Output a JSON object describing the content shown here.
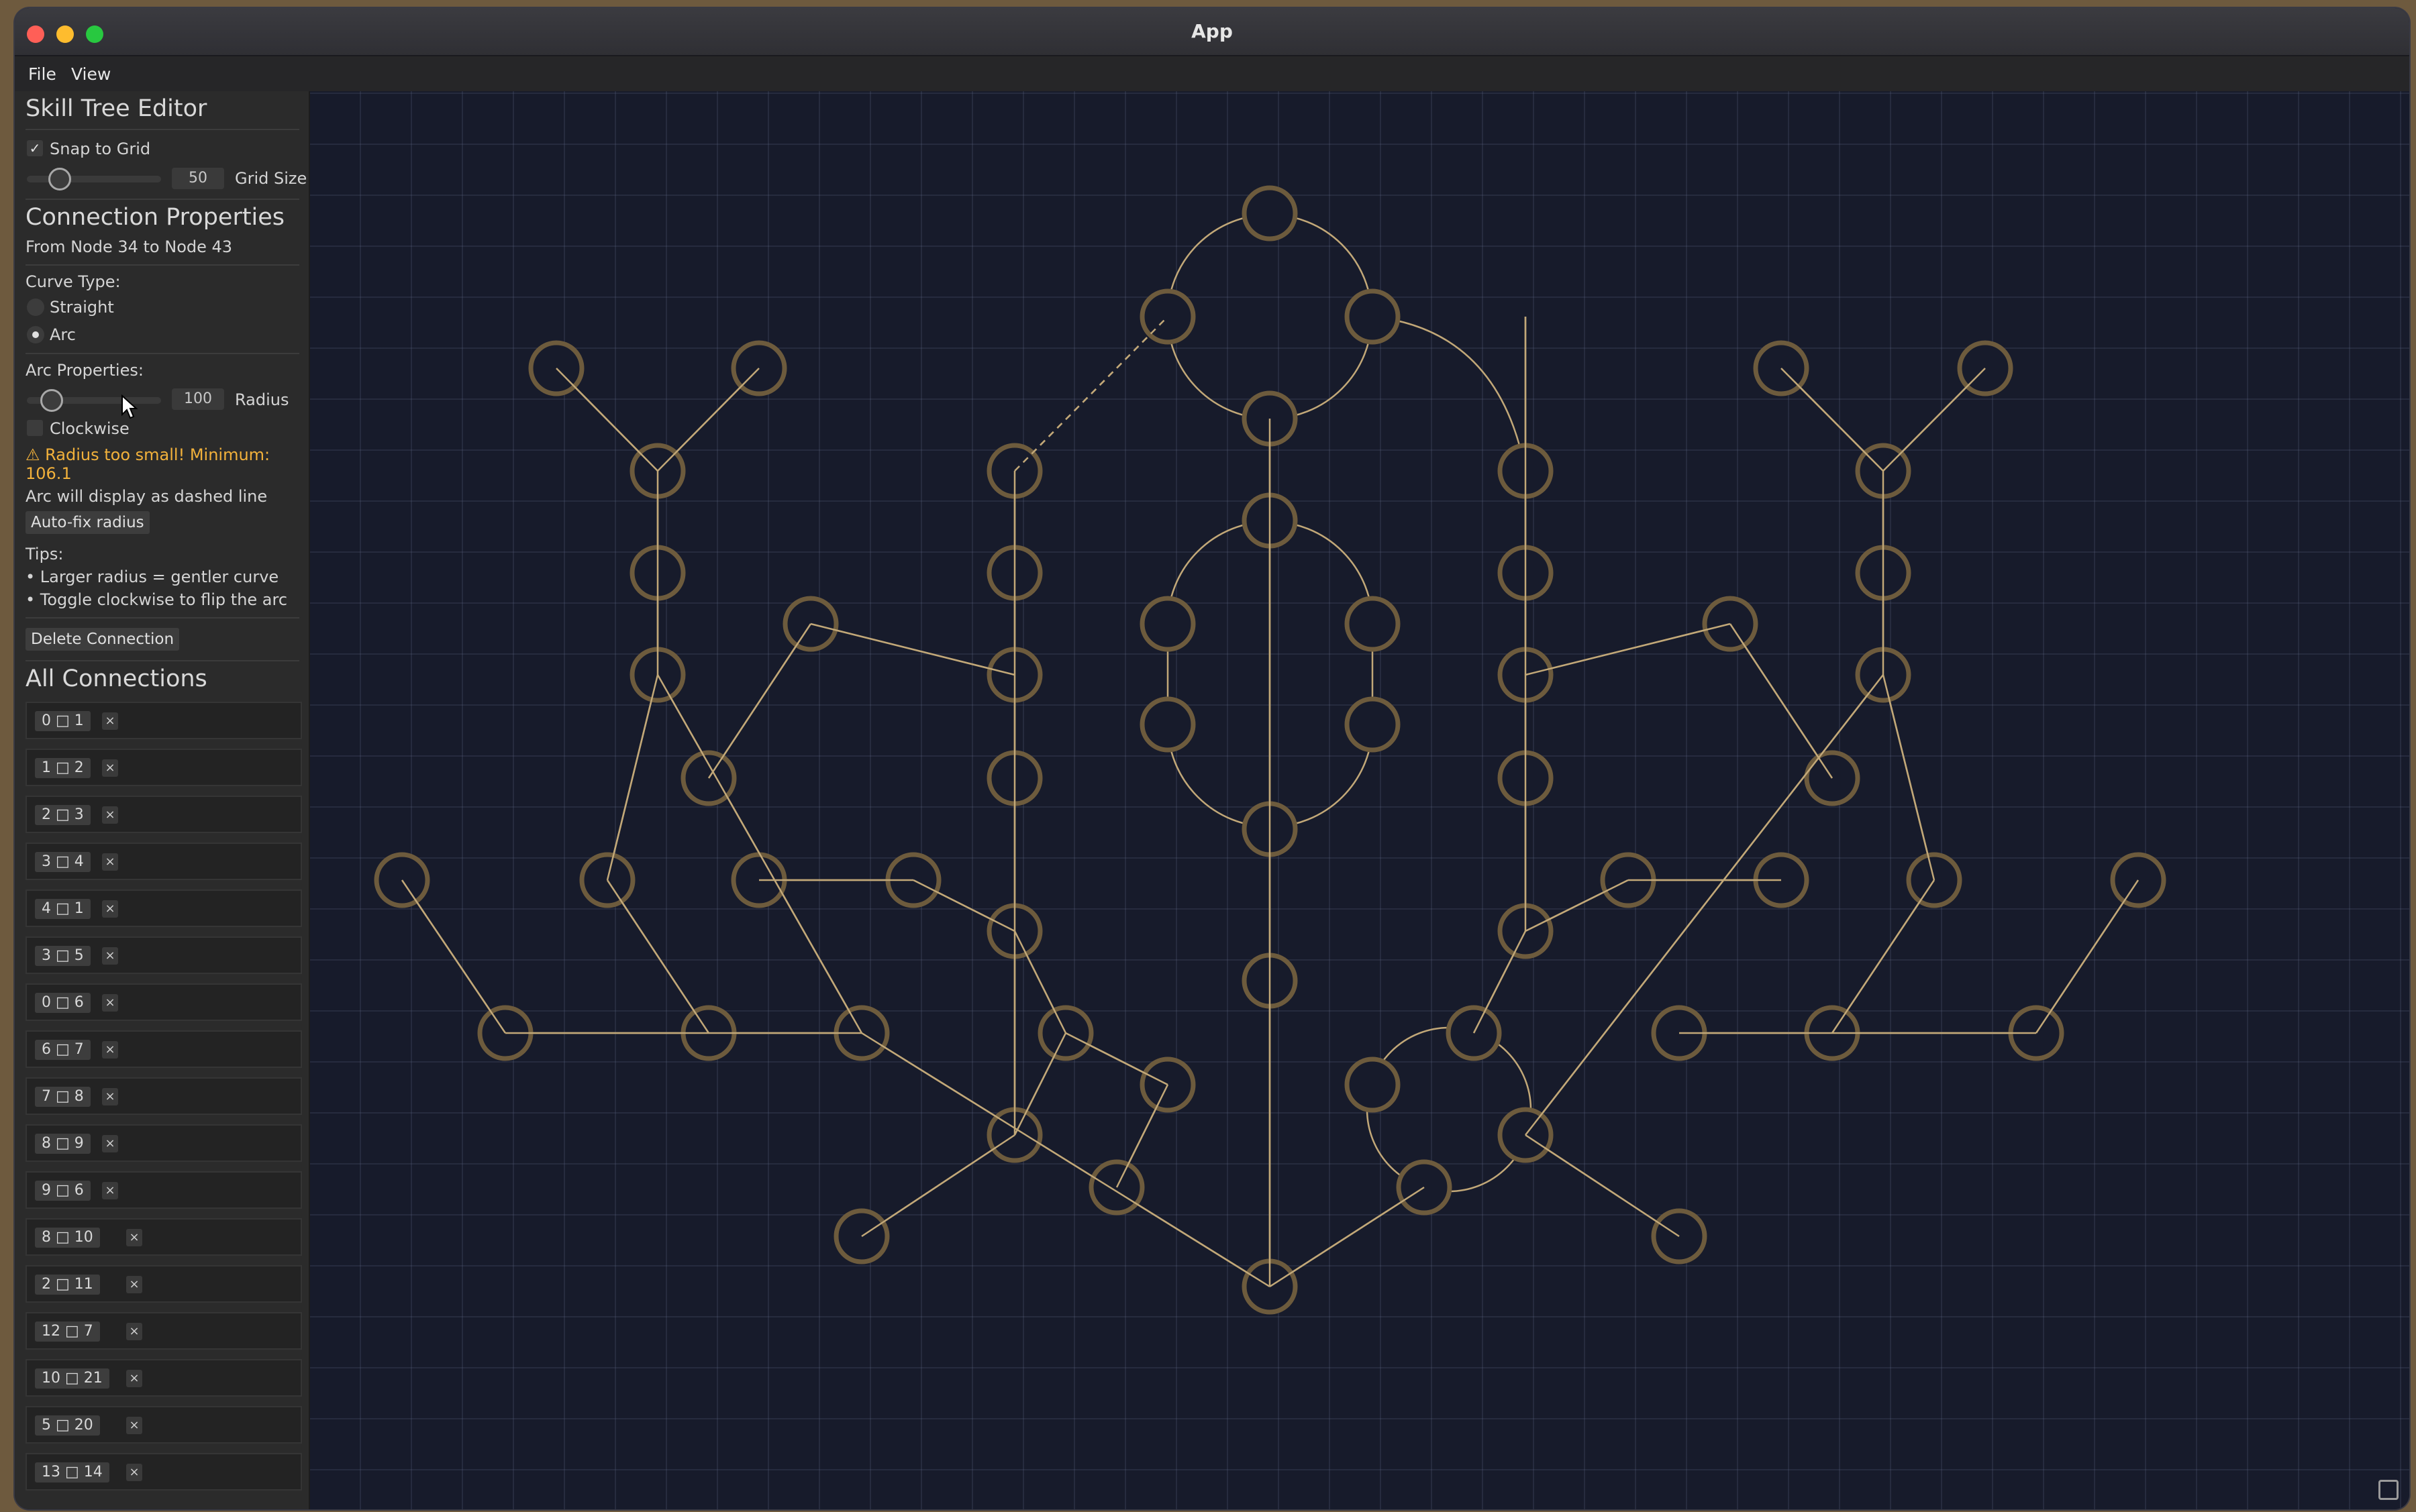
{
  "window": {
    "title": "App"
  },
  "menu": {
    "items": [
      "File",
      "View"
    ]
  },
  "sidebar": {
    "title": "Skill Tree Editor",
    "snap_to_grid_label": "Snap to Grid",
    "snap_checked": true,
    "grid_size_value": "50",
    "grid_size_label": "Grid Size",
    "connection_title": "Connection Properties",
    "connection_subtitle": "From Node 34 to Node 43",
    "curve_type_label": "Curve Type:",
    "curve_options": [
      "Straight",
      "Arc"
    ],
    "curve_selected": "Arc",
    "arc_props_label": "Arc Properties:",
    "radius_value": "100",
    "radius_label": "Radius",
    "clockwise_label": "Clockwise",
    "clockwise_checked": false,
    "warning_line1": "⚠ Radius too small! Minimum:",
    "warning_line2": "106.1",
    "dashed_note": "Arc will display as dashed line",
    "autofix_label": "Auto-fix radius",
    "tips_label": "Tips:",
    "tips": [
      "• Larger radius = gentler curve",
      "• Toggle clockwise to flip the arc"
    ],
    "delete_label": "Delete Connection",
    "all_connections_title": "All Connections",
    "connections": [
      "0 □ 1",
      "1 □ 2",
      "2 □ 3",
      "3 □ 4",
      "4 □ 1",
      "3 □ 5",
      "0 □ 6",
      "6 □ 7",
      "7 □ 8",
      "8 □ 9",
      "9 □ 6",
      "8 □ 10",
      "2 □ 11",
      "12 □ 7",
      "10 □ 21",
      "5 □ 20",
      "13 □ 14"
    ],
    "remove_symbol": "×"
  },
  "colors": {
    "node_stroke": "#6d5b3d",
    "edge": "#c2a878",
    "canvas_bg": "#171b2b"
  },
  "icons": {
    "corner": "screenshot-capture-icon"
  }
}
